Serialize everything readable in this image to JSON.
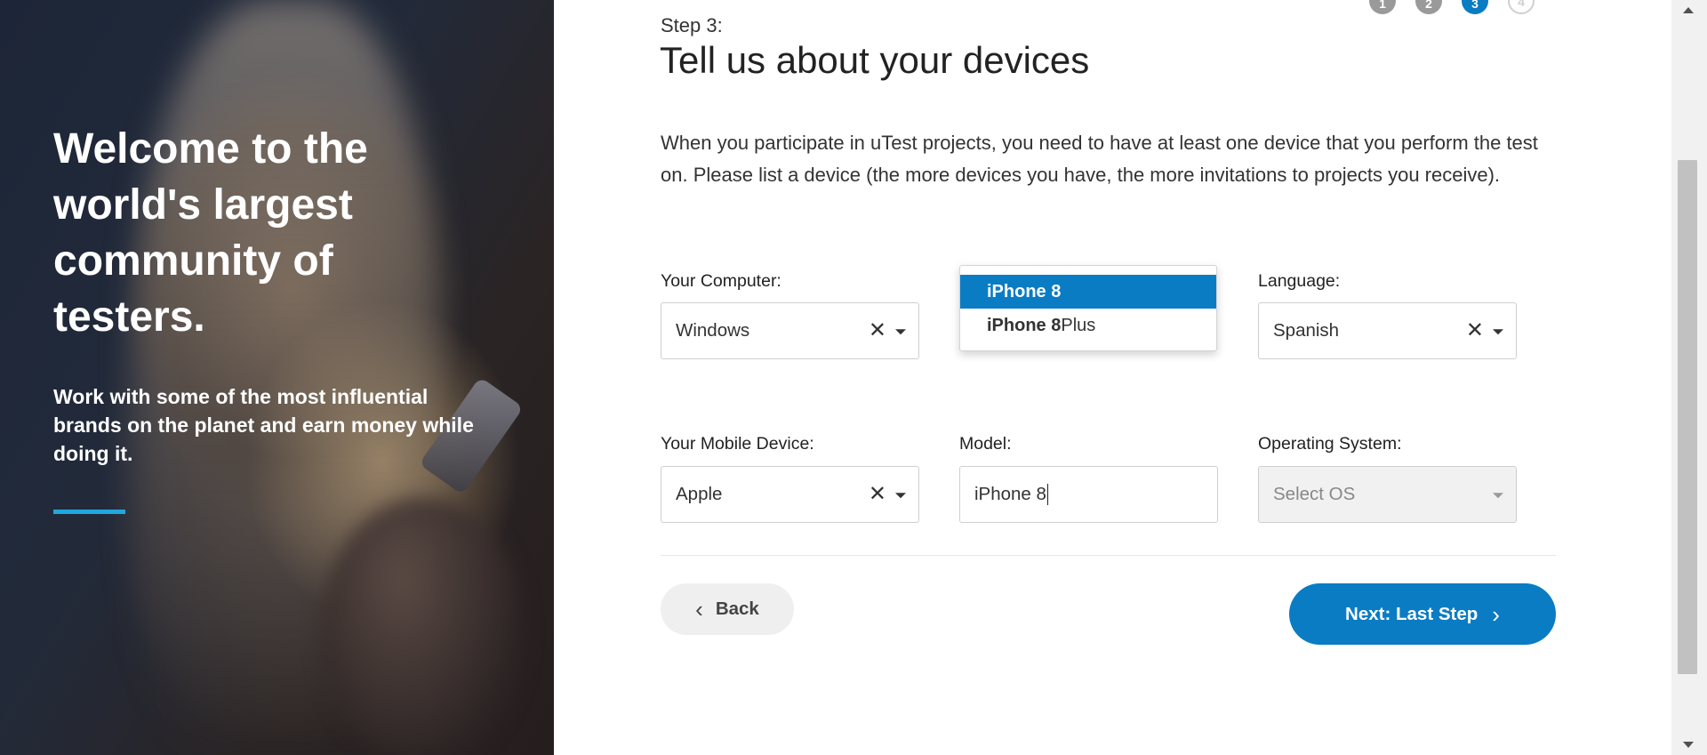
{
  "hero": {
    "title": "Welcome to the world's largest community of testers.",
    "subtitle": "Work with some of the most influential brands on the planet and earn money while doing it."
  },
  "stepper": {
    "steps": [
      "1",
      "2",
      "3",
      "4"
    ],
    "current": 3
  },
  "form": {
    "step_label": "Step 3:",
    "title": "Tell us about your devices",
    "intro": "When you participate in uTest projects, you need to have at least one device that you perform the test on. Please list a device (the more devices you have, the more invitations to projects you receive).",
    "computer": {
      "label": "Your Computer:",
      "value": "Windows"
    },
    "language": {
      "label": "Language:",
      "value": "Spanish"
    },
    "mobile": {
      "label": "Your Mobile Device:",
      "value": "Apple"
    },
    "model": {
      "label": "Model:",
      "value": "iPhone 8"
    },
    "os": {
      "label": "Operating System:",
      "placeholder": "Select OS"
    },
    "clear_glyph": "✕",
    "model_suggestions": [
      {
        "match": "iPhone 8",
        "rest": "",
        "active": true
      },
      {
        "match": "iPhone 8",
        "rest": " Plus",
        "active": false
      }
    ]
  },
  "buttons": {
    "back": "Back",
    "next": "Next: Last Step"
  },
  "colors": {
    "accent": "#0a7cc4",
    "hero_bar": "#1ea8e0"
  },
  "icons": [
    "chevron-left-icon",
    "chevron-right-icon",
    "close-icon",
    "caret-down-icon"
  ]
}
